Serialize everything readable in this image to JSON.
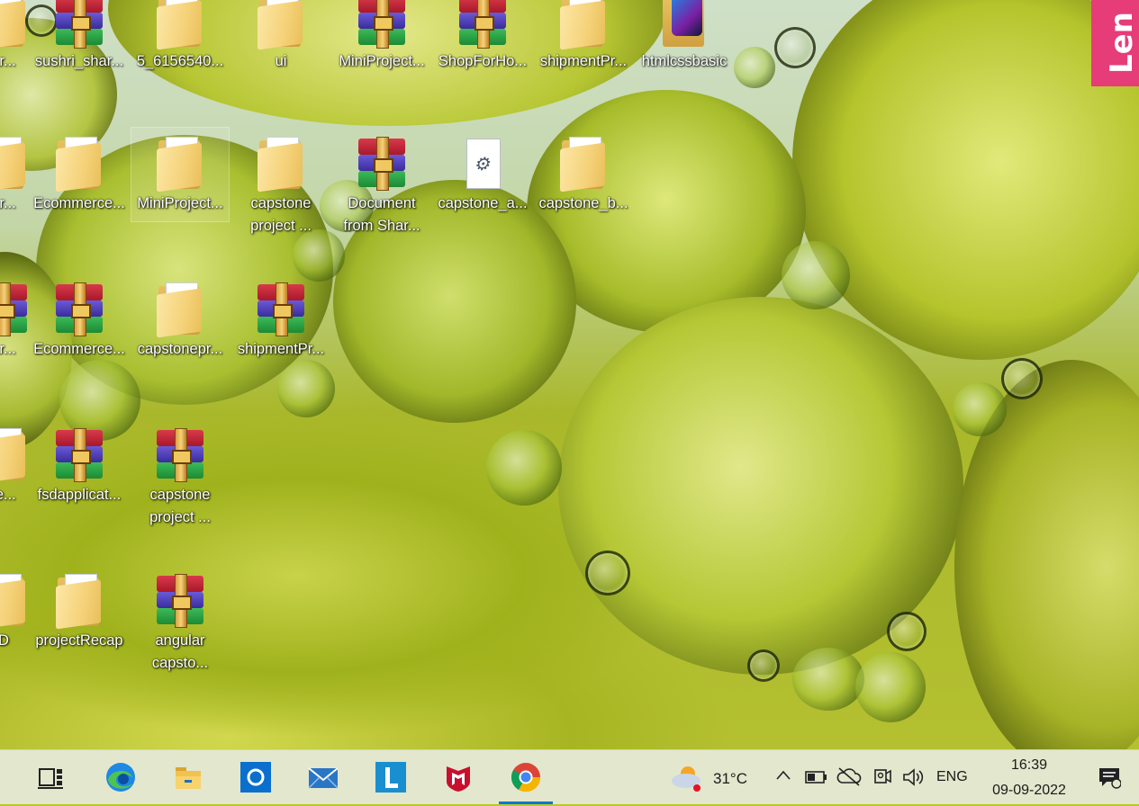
{
  "desktop": {
    "brand_tab": "Len",
    "icons": [
      {
        "label": "ar...",
        "type": "folder"
      },
      {
        "label": "sushri_shar...",
        "type": "rar"
      },
      {
        "label": "5_6156540...",
        "type": "folder"
      },
      {
        "label": "ui",
        "type": "folder"
      },
      {
        "label": "MiniProject...",
        "type": "rar"
      },
      {
        "label": "ShopForHo...",
        "type": "rar"
      },
      {
        "label": "shipmentPr...",
        "type": "folder"
      },
      {
        "label": "htmlcssbasic",
        "type": "edge"
      },
      {
        "label": "ar...",
        "type": "folder"
      },
      {
        "label": "Ecommerce...",
        "type": "folder"
      },
      {
        "label": "MiniProject...",
        "type": "folder"
      },
      {
        "label": "capstone\nproject ...",
        "type": "folder"
      },
      {
        "label": "Document\nfrom Shar...",
        "type": "rar"
      },
      {
        "label": "capstone_a...",
        "type": "file"
      },
      {
        "label": "capstone_b...",
        "type": "folder"
      },
      {
        "label": "ar...",
        "type": "rar"
      },
      {
        "label": "Ecommerce...",
        "type": "rar"
      },
      {
        "label": "capstonepr...",
        "type": "folder"
      },
      {
        "label": "shipmentPr...",
        "type": "rar"
      },
      {
        "label": "/e...",
        "type": "folder"
      },
      {
        "label": "fsdapplicat...",
        "type": "rar"
      },
      {
        "label": "capstone\nproject ...",
        "type": "rar"
      },
      {
        "label": "D",
        "type": "folder"
      },
      {
        "label": "projectRecap",
        "type": "folder"
      },
      {
        "label": "angular\ncapsto...",
        "type": "rar"
      }
    ]
  },
  "taskbar": {
    "apps": [
      {
        "name": "task-view",
        "icon": "task-view-icon"
      },
      {
        "name": "microsoft-edge",
        "icon": "edge-icon"
      },
      {
        "name": "file-explorer",
        "icon": "folder-icon"
      },
      {
        "name": "cortana",
        "icon": "cortana-icon"
      },
      {
        "name": "mail",
        "icon": "mail-icon"
      },
      {
        "name": "lenovo-vantage",
        "icon": "lenovo-l-icon"
      },
      {
        "name": "mcafee",
        "icon": "mcafee-icon"
      },
      {
        "name": "google-chrome",
        "icon": "chrome-icon",
        "active": true
      }
    ],
    "weather": {
      "temp": "31°C",
      "icon": "partly-cloudy-icon"
    },
    "language": "ENG",
    "clock": {
      "time": "16:39",
      "date": "09-09-2022"
    },
    "accent": "#0078d4"
  }
}
